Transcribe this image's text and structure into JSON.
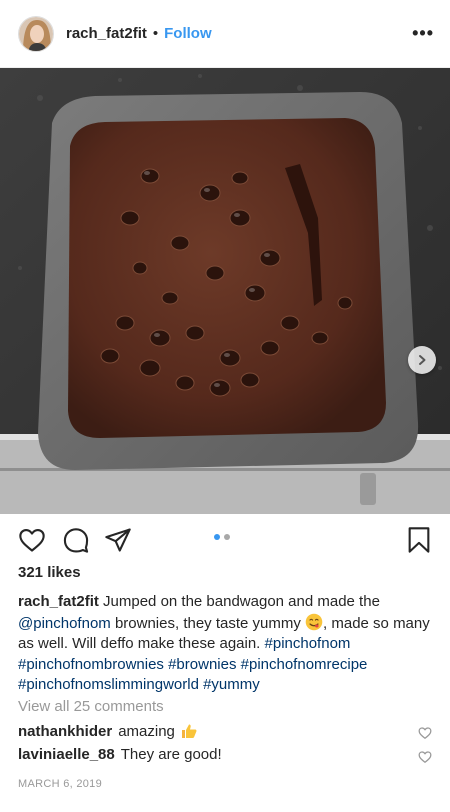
{
  "post": {
    "username": "rach_fat2fit",
    "separator": "•",
    "follow_label": "Follow",
    "more_label": "•••"
  },
  "icons": {
    "avatar": "profile-photo",
    "more": "more-options-icon",
    "next": "chevron-right-icon",
    "tag": "user-tag-icon",
    "like": "heart-outline-icon",
    "comment": "comment-bubble-icon",
    "share": "paper-plane-icon",
    "save": "bookmark-outline-icon",
    "emoji_yum": "savoring-food-emoji",
    "emoji_thumbs": "thumbs-up-emoji"
  },
  "carousel": {
    "total": 2,
    "active": 1
  },
  "likes_text": "321 likes",
  "caption": {
    "user": "rach_fat2fit",
    "part1": "Jumped on the bandwagon and made the",
    "mention": "@pinchofnom",
    "part2": "brownies, they taste yummy",
    "part3": ", made so many as well. Will deffo make these again.",
    "hashtags": [
      "#pinchofnom",
      "#pinchofnombrownies",
      "#brownies",
      "#pinchofnomrecipe",
      "#pinchofnomslimmingworld",
      "#yummy"
    ]
  },
  "view_all_comments": "View all 25 comments",
  "comments": [
    {
      "user": "nathankhider",
      "text": "amazing"
    },
    {
      "user": "laviniaelle_88",
      "text": "They are good!"
    }
  ],
  "date": "MARCH 6, 2019",
  "colors": {
    "link_blue": "#3897f0",
    "hashtag": "#003569",
    "muted": "#999999",
    "text": "#262626"
  }
}
